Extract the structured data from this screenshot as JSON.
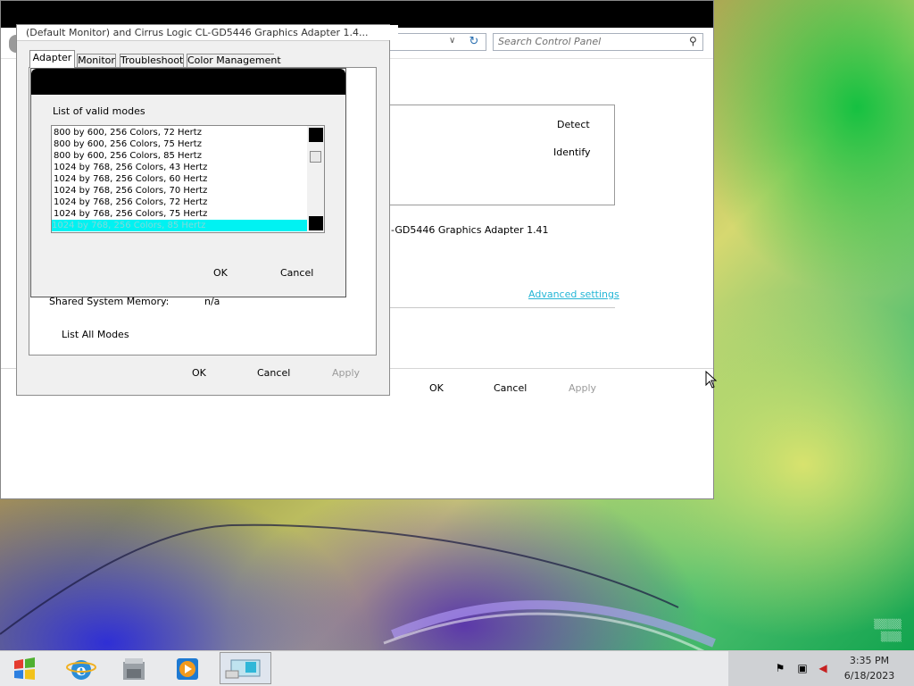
{
  "control_panel": {
    "search_placeholder": "Search Control Panel",
    "detect_label": "Detect",
    "identify_label": "Identify",
    "adapter_text": "-GD5446 Graphics Adapter 1.41",
    "advanced_link": "Advanced settings",
    "ok_label": "OK",
    "cancel_label": "Cancel",
    "apply_label": "Apply"
  },
  "properties": {
    "title": "(Default Monitor) and Cirrus Logic CL-GD5446 Graphics Adapter 1.4...",
    "tabs": [
      {
        "label": "Adapter"
      },
      {
        "label": "Monitor"
      },
      {
        "label": "Troubleshoot"
      },
      {
        "label": "Color Management"
      }
    ],
    "shared_memory_label": "Shared System Memory:",
    "shared_memory_value": "n/a",
    "list_all_modes_label": "List All Modes",
    "ok_label": "OK",
    "cancel_label": "Cancel",
    "apply_label": "Apply"
  },
  "modes_dialog": {
    "list_label": "List of valid modes",
    "modes": [
      "800 by 600, 256 Colors, 72 Hertz",
      "800 by 600, 256 Colors, 75 Hertz",
      "800 by 600, 256 Colors, 85 Hertz",
      "1024 by 768, 256 Colors, 43 Hertz",
      "1024 by 768, 256 Colors, 60 Hertz",
      "1024 by 768, 256 Colors, 70 Hertz",
      "1024 by 768, 256 Colors, 72 Hertz",
      "1024 by 768, 256 Colors, 75 Hertz",
      "1024 by 768, 256 Colors, 85 Hertz"
    ],
    "selected_mode": "1024 by 768, 256 Colors, 85 Hertz",
    "ok_label": "OK",
    "cancel_label": "Cancel"
  },
  "taskbar": {
    "icons": [
      "windows-start-icon",
      "internet-explorer-icon",
      "windows-explorer-icon",
      "media-player-icon",
      "control-panel-icon"
    ],
    "tray_icons": [
      "flag-icon",
      "network-icon",
      "volume-muted-icon"
    ],
    "time": "3:35 PM",
    "date": "6/18/2023"
  },
  "colors": {
    "selection": "#00f2f2",
    "link": "#25b6d6",
    "titlebar": "#000000"
  }
}
